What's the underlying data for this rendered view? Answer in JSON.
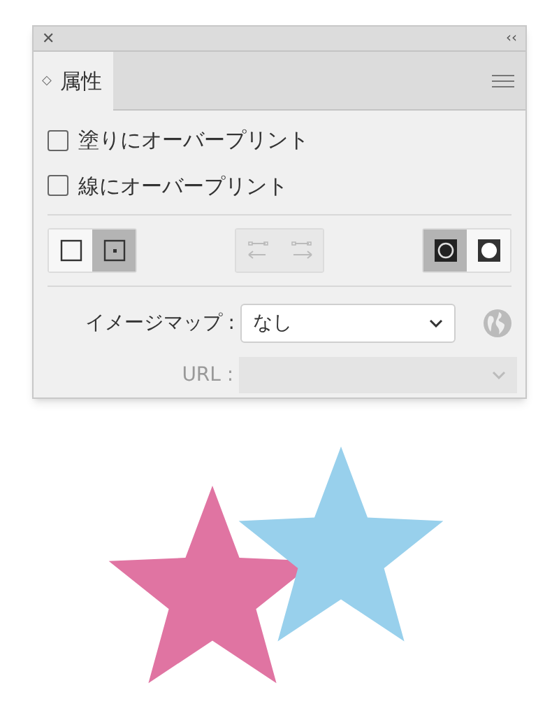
{
  "panel": {
    "close": "✕",
    "collapse": "‹‹",
    "tab": {
      "icon": "◇",
      "label": "属性",
      "selected": true
    }
  },
  "checkboxes": [
    {
      "label": "塗りにオーバープリント",
      "checked": false
    },
    {
      "label": "線にオーバープリント",
      "checked": false
    }
  ],
  "toggle_groups": [
    {
      "disabled": false,
      "buttons": [
        {
          "kind": "square",
          "selected": false
        },
        {
          "kind": "square-dot",
          "selected": true
        }
      ]
    },
    {
      "disabled": true,
      "buttons": [
        {
          "kind": "arrow-left",
          "selected": false
        },
        {
          "kind": "arrow-right",
          "selected": false
        }
      ]
    },
    {
      "disabled": false,
      "buttons": [
        {
          "kind": "ring",
          "selected": true
        },
        {
          "kind": "disc",
          "selected": false
        }
      ]
    }
  ],
  "image_map": {
    "label": "イメージマップ :",
    "value": "なし"
  },
  "url": {
    "label": "URL :",
    "disabled": true
  },
  "artwork": [
    {
      "kind": "star",
      "color": "#e074a2"
    },
    {
      "kind": "star",
      "color": "#98d0ec"
    }
  ]
}
